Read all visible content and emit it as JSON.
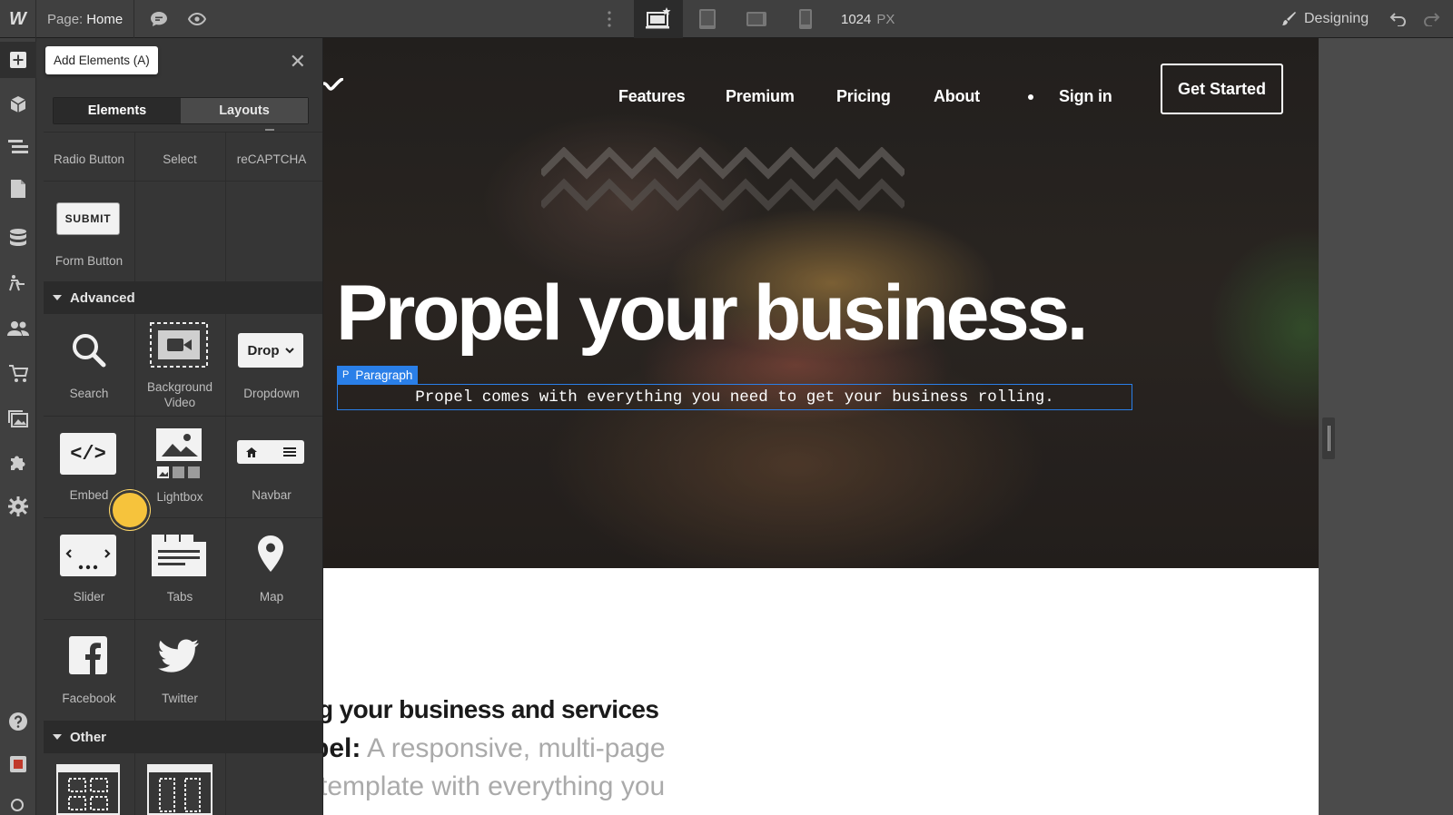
{
  "topbar": {
    "logo": "W",
    "page_label": "Page:",
    "page_name": "Home",
    "width_value": "1024",
    "width_unit": "PX",
    "mode": "Designing"
  },
  "tooltip": {
    "text": "Add Elements (A)"
  },
  "panel": {
    "tabs": {
      "elements": "Elements",
      "layouts": "Layouts"
    },
    "forms_row": [
      "Radio Button",
      "Select",
      "reCAPTCHA"
    ],
    "form_button": {
      "preview": "SUBMIT",
      "label": "Form Button"
    },
    "sections": {
      "advanced": "Advanced",
      "other": "Other"
    },
    "advanced_items": {
      "search": "Search",
      "background_video": "Background Video",
      "dropdown": "Dropdown",
      "dropdown_preview": "Drop",
      "embed": "Embed",
      "lightbox": "Lightbox",
      "navbar": "Navbar",
      "slider": "Slider",
      "tabs": "Tabs",
      "map": "Map",
      "facebook": "Facebook",
      "twitter": "Twitter"
    }
  },
  "site": {
    "nav": [
      "Features",
      "Premium",
      "Pricing",
      "About",
      "Sign in"
    ],
    "cta": "Get Started",
    "hero_title": "Propel your business.",
    "selection_tag": "Paragraph",
    "selection_tag_letter": "P",
    "hero_paragraph": "Propel comes with everything you need to get your business rolling.",
    "section_heading": "g your business and services",
    "section_body_bold": "pel:",
    "section_body_1": " A responsive, multi-page",
    "section_body_2": "template with everything you"
  }
}
